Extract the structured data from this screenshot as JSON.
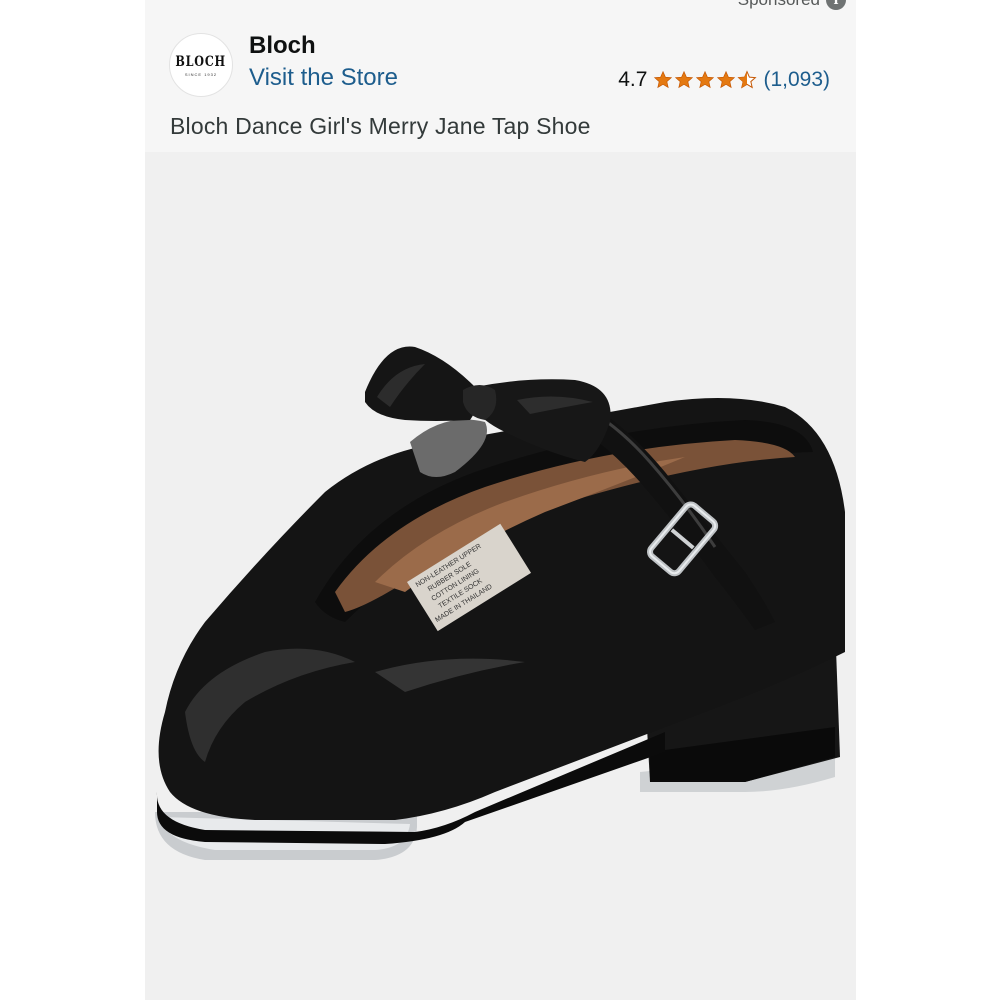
{
  "header": {
    "sponsored_label": "Sponsored",
    "info_icon": "info-icon"
  },
  "brand": {
    "logo_text": "BLOCH",
    "logo_subtext": "SINCE 1932",
    "name": "Bloch",
    "store_link": "Visit the Store"
  },
  "rating": {
    "value": "4.7",
    "stars_out_of_5": 4.7,
    "count": "(1,093)",
    "star_color": "#e47911"
  },
  "product": {
    "title": "Bloch Dance Girl's Merry Jane Tap Shoe",
    "label_lines": [
      "NON-LEATHER UPPER",
      "RUBBER SOLE",
      "COTTON LINING",
      "TEXTILE SOCK",
      "MADE IN THAILAND"
    ]
  },
  "colors": {
    "link": "#1d5d8d",
    "background": "#f6f6f6",
    "image_background": "#f0f0f0"
  }
}
